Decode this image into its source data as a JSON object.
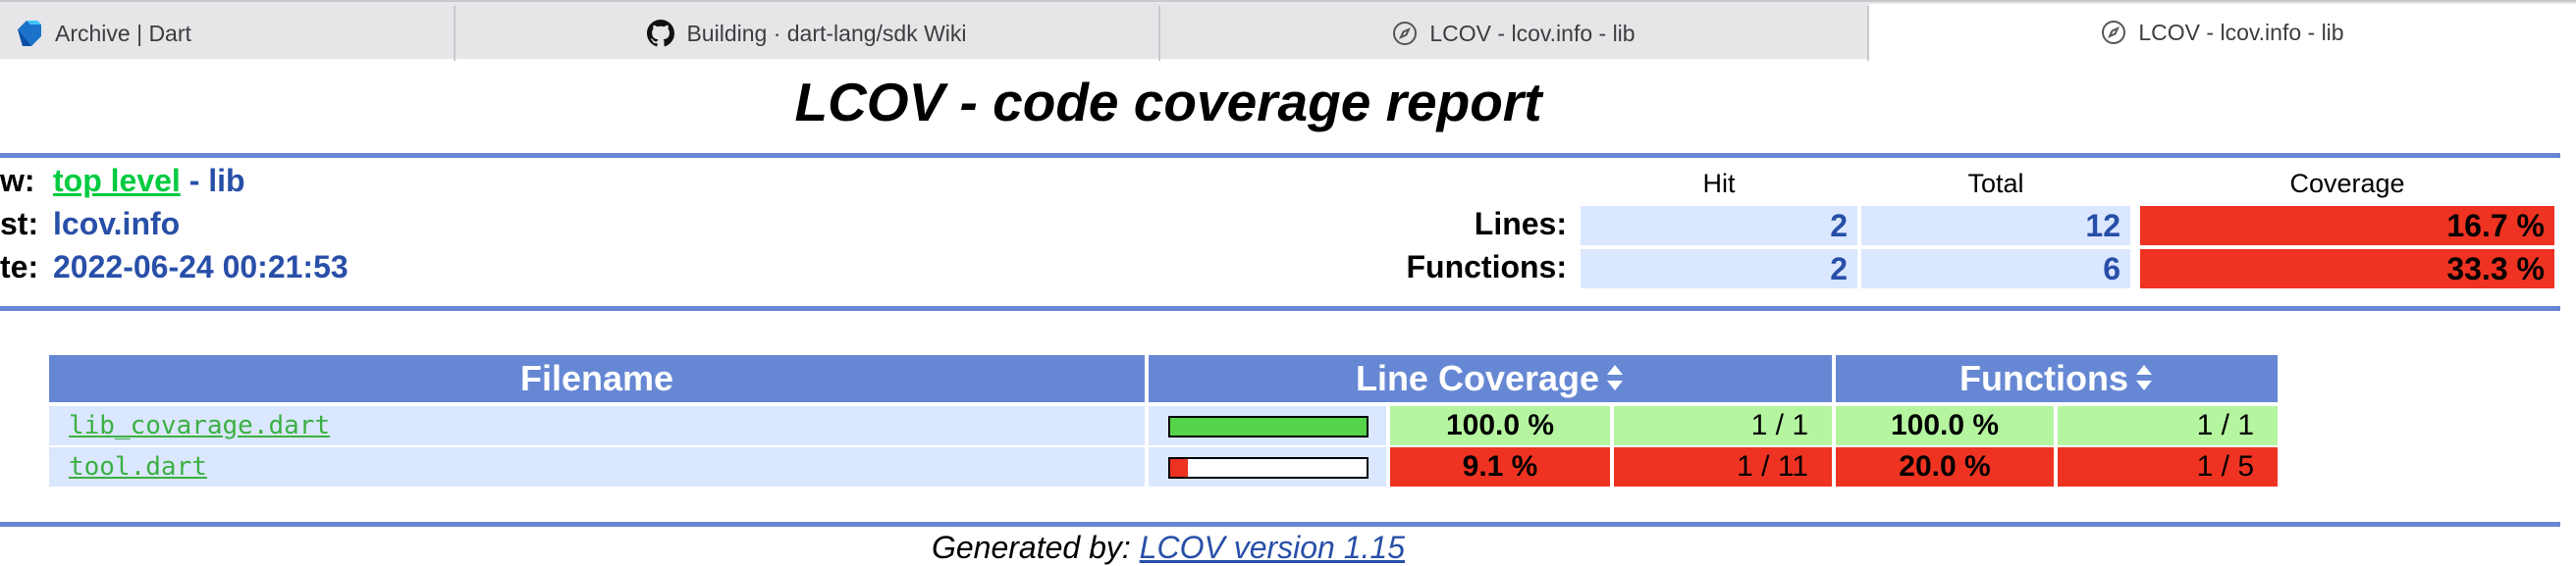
{
  "tabs": [
    {
      "label": "Archive | Dart",
      "icon": "dart-logo-icon",
      "active": false
    },
    {
      "label": "Building · dart-lang/sdk Wiki",
      "icon": "github-icon",
      "active": false
    },
    {
      "label": "LCOV - lcov.info - lib",
      "icon": "compass-icon",
      "active": false
    },
    {
      "label": "LCOV - lcov.info - lib",
      "icon": "compass-icon",
      "active": true
    }
  ],
  "header": {
    "title": "LCOV - code coverage report"
  },
  "info": {
    "view_label": "w:",
    "view_link": "top level",
    "view_rest": " - lib",
    "test_label": "st:",
    "test_value": "lcov.info",
    "date_label": "te:",
    "date_value": "2022-06-24 00:21:53"
  },
  "summary": {
    "col_hit": "Hit",
    "col_total": "Total",
    "col_coverage": "Coverage",
    "rows": [
      {
        "label": "Lines:",
        "hit": "2",
        "total": "12",
        "coverage": "16.7 %"
      },
      {
        "label": "Functions:",
        "hit": "2",
        "total": "6",
        "coverage": "33.3 %"
      }
    ]
  },
  "files": {
    "col_filename": "Filename",
    "col_line_coverage": "Line Coverage",
    "col_functions": "Functions",
    "rows": [
      {
        "name": "lib_covarage.dart",
        "bar_fraction": 1.0,
        "bar_color": "#55d44a",
        "line_pct": "100.0 %",
        "line_ratio": "1 / 1",
        "func_pct": "100.0 %",
        "func_ratio": "1 / 1",
        "status": "green"
      },
      {
        "name": "tool.dart",
        "bar_fraction": 0.091,
        "bar_color": "#ee3322",
        "line_pct": "9.1 %",
        "line_ratio": "1 / 11",
        "func_pct": "20.0 %",
        "func_ratio": "1 / 5",
        "status": "red"
      }
    ]
  },
  "footer": {
    "prefix": "Generated by: ",
    "link": "LCOV version 1.15"
  },
  "colors": {
    "accent_rule": "#6688d4",
    "link_blue": "#284fa8",
    "link_green": "#00cb40",
    "hi_cov": "#b6f5a0",
    "lo_cov": "#ee3322"
  }
}
